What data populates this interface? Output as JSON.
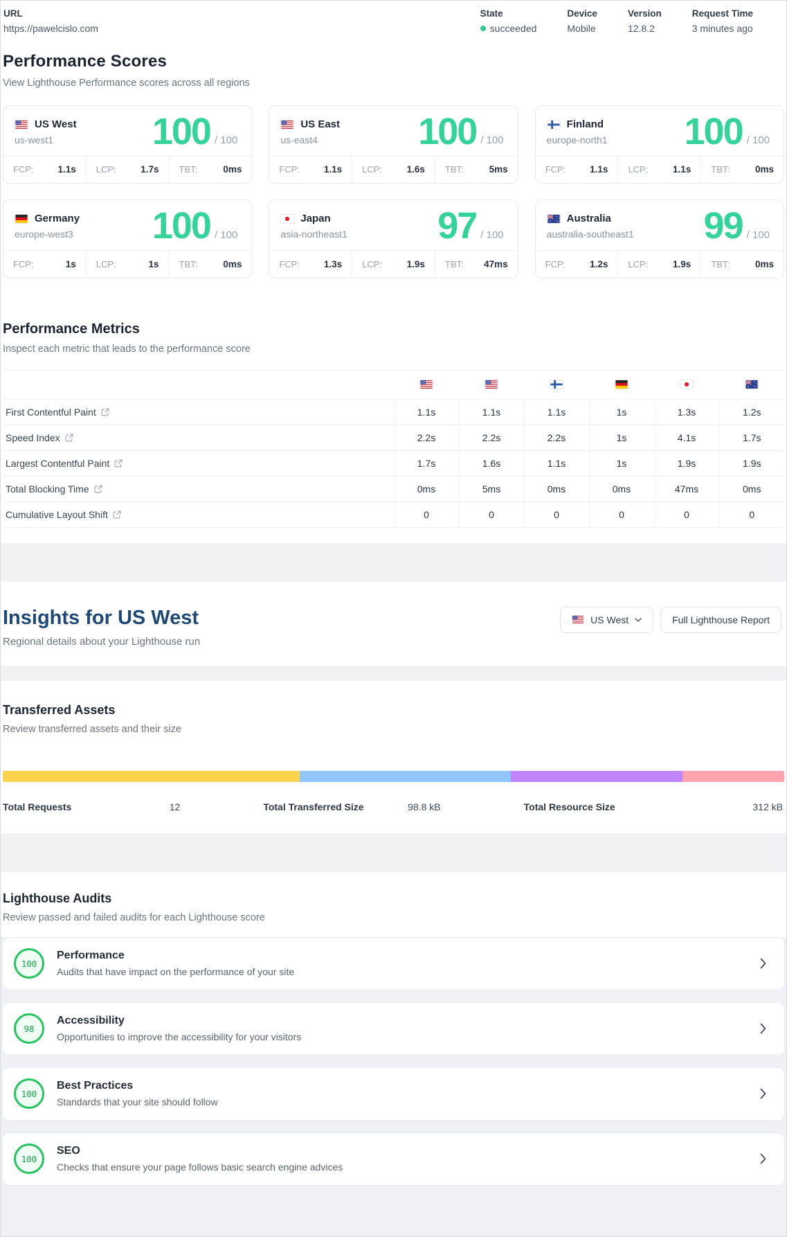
{
  "header": {
    "url_label": "URL",
    "url_value": "https://pawelcislo.com",
    "state_label": "State",
    "state_value": "succeeded",
    "device_label": "Device",
    "device_value": "Mobile",
    "version_label": "Version",
    "version_value": "12.8.2",
    "request_time_label": "Request Time",
    "request_time_value": "3 minutes ago",
    "state_dot_color": "#2ecc8f"
  },
  "performance_scores": {
    "title": "Performance Scores",
    "subtitle": "View Lighthouse Performance scores across all regions",
    "score_color": "#34d399",
    "cards": [
      {
        "flag": "us-flag-icon",
        "country": "US West",
        "region": "us-west1",
        "score": "100",
        "denom": "/ 100",
        "metrics": [
          {
            "label": "FCP:",
            "value": "1.1s"
          },
          {
            "label": "LCP:",
            "value": "1.7s"
          },
          {
            "label": "TBT:",
            "value": "0ms"
          }
        ]
      },
      {
        "flag": "us-flag-icon",
        "country": "US East",
        "region": "us-east4",
        "score": "100",
        "denom": "/ 100",
        "metrics": [
          {
            "label": "FCP:",
            "value": "1.1s"
          },
          {
            "label": "LCP:",
            "value": "1.6s"
          },
          {
            "label": "TBT:",
            "value": "5ms"
          }
        ]
      },
      {
        "flag": "finland-flag-icon",
        "country": "Finland",
        "region": "europe-north1",
        "score": "100",
        "denom": "/ 100",
        "metrics": [
          {
            "label": "FCP:",
            "value": "1.1s"
          },
          {
            "label": "LCP:",
            "value": "1.1s"
          },
          {
            "label": "TBT:",
            "value": "0ms"
          }
        ]
      },
      {
        "flag": "germany-flag-icon",
        "country": "Germany",
        "region": "europe-west3",
        "score": "100",
        "denom": "/ 100",
        "metrics": [
          {
            "label": "FCP:",
            "value": "1s"
          },
          {
            "label": "LCP:",
            "value": "1s"
          },
          {
            "label": "TBT:",
            "value": "0ms"
          }
        ]
      },
      {
        "flag": "japan-flag-icon",
        "country": "Japan",
        "region": "asia-northeast1",
        "score": "97",
        "denom": "/ 100",
        "metrics": [
          {
            "label": "FCP:",
            "value": "1.3s"
          },
          {
            "label": "LCP:",
            "value": "1.9s"
          },
          {
            "label": "TBT:",
            "value": "47ms"
          }
        ]
      },
      {
        "flag": "australia-flag-icon",
        "country": "Australia",
        "region": "australia-southeast1",
        "score": "99",
        "denom": "/ 100",
        "metrics": [
          {
            "label": "FCP:",
            "value": "1.2s"
          },
          {
            "label": "LCP:",
            "value": "1.9s"
          },
          {
            "label": "TBT:",
            "value": "0ms"
          }
        ]
      }
    ]
  },
  "performance_metrics": {
    "title": "Performance Metrics",
    "subtitle": "Inspect each metric that leads to the performance score",
    "columns": [
      "us-flag-icon",
      "us-flag-icon",
      "finland-flag-icon",
      "germany-flag-icon",
      "japan-flag-icon",
      "australia-flag-icon"
    ],
    "rows": [
      {
        "label": "First Contentful Paint",
        "values": [
          "1.1s",
          "1.1s",
          "1.1s",
          "1s",
          "1.3s",
          "1.2s"
        ]
      },
      {
        "label": "Speed Index",
        "values": [
          "2.2s",
          "2.2s",
          "2.2s",
          "1s",
          "4.1s",
          "1.7s"
        ]
      },
      {
        "label": "Largest Contentful Paint",
        "values": [
          "1.7s",
          "1.6s",
          "1.1s",
          "1s",
          "1.9s",
          "1.9s"
        ]
      },
      {
        "label": "Total Blocking Time",
        "values": [
          "0ms",
          "5ms",
          "0ms",
          "0ms",
          "47ms",
          "0ms"
        ]
      },
      {
        "label": "Cumulative Layout Shift",
        "values": [
          "0",
          "0",
          "0",
          "0",
          "0",
          "0"
        ]
      }
    ]
  },
  "insights": {
    "title": "Insights for US West",
    "subtitle": "Regional details about your Lighthouse run",
    "region_selector_label": "US West",
    "report_button_label": "Full Lighthouse Report"
  },
  "transferred_assets": {
    "title": "Transferred Assets",
    "subtitle": "Review transferred assets and their size",
    "bar_segments": [
      {
        "color": "#fcd34d",
        "pct": 38
      },
      {
        "color": "#93c5fd",
        "pct": 27
      },
      {
        "color": "#c084fc",
        "pct": 22
      },
      {
        "color": "#fda4af",
        "pct": 13
      }
    ],
    "stats": [
      {
        "label": "Total Requests",
        "value": "12"
      },
      {
        "label": "Total Transferred Size",
        "value": "98.8 kB"
      },
      {
        "label": "Total Resource Size",
        "value": "312 kB"
      }
    ]
  },
  "audits": {
    "title": "Lighthouse Audits",
    "subtitle": "Review passed and failed audits for each Lighthouse score",
    "badge_color": "#22c55e",
    "items": [
      {
        "score": "100",
        "name": "Performance",
        "desc": "Audits that have impact on the performance of your site"
      },
      {
        "score": "98",
        "name": "Accessibility",
        "desc": "Opportunities to improve the accessibility for your visitors"
      },
      {
        "score": "100",
        "name": "Best Practices",
        "desc": "Standards that your site should follow"
      },
      {
        "score": "100",
        "name": "SEO",
        "desc": "Checks that ensure your page follows basic search engine advices"
      }
    ]
  }
}
